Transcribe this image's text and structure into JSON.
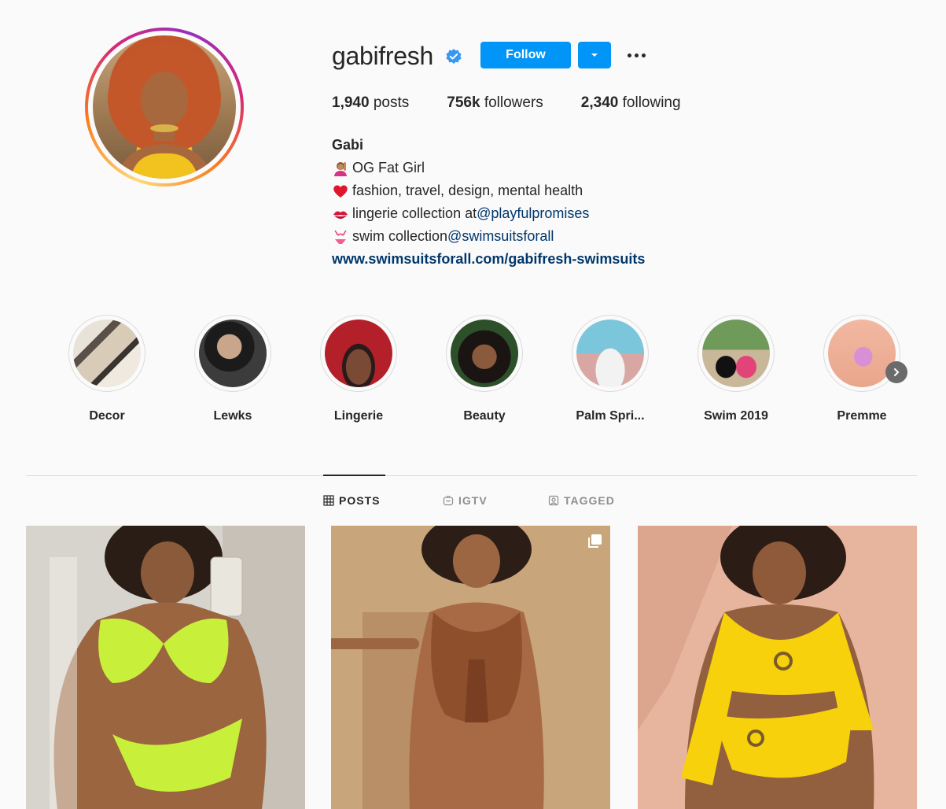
{
  "profile": {
    "username": "gabifresh",
    "follow_label": "Follow"
  },
  "stats": [
    {
      "count": "1,940",
      "label": "posts"
    },
    {
      "count": "756k",
      "label": "followers"
    },
    {
      "count": "2,340",
      "label": "following"
    }
  ],
  "bio": {
    "name": "Gabi",
    "line1": "OG Fat Girl",
    "line2": " fashion, travel, design, mental health",
    "line3_text": "lingerie collection at ",
    "line3_mention": "@playfulpromises",
    "line4_text": "swim collection ",
    "line4_mention": "@swimsuitsforall",
    "link": "www.swimsuitsforall.com/gabifresh-swimsuits"
  },
  "highlights": [
    {
      "label": "Decor"
    },
    {
      "label": "Lewks"
    },
    {
      "label": "Lingerie"
    },
    {
      "label": "Beauty"
    },
    {
      "label": "Palm Spri..."
    },
    {
      "label": "Swim 2019"
    },
    {
      "label": "Premme"
    }
  ],
  "tabs": [
    {
      "label": "POSTS",
      "icon": "grid-icon",
      "active": true
    },
    {
      "label": "IGTV",
      "icon": "igtv-icon",
      "active": false
    },
    {
      "label": "TAGGED",
      "icon": "tagged-icon",
      "active": false
    }
  ],
  "colors": {
    "accent": "#0095f6",
    "link": "#00376b",
    "text": "#262626",
    "muted": "#8e8e8e",
    "background": "#fafafa"
  }
}
